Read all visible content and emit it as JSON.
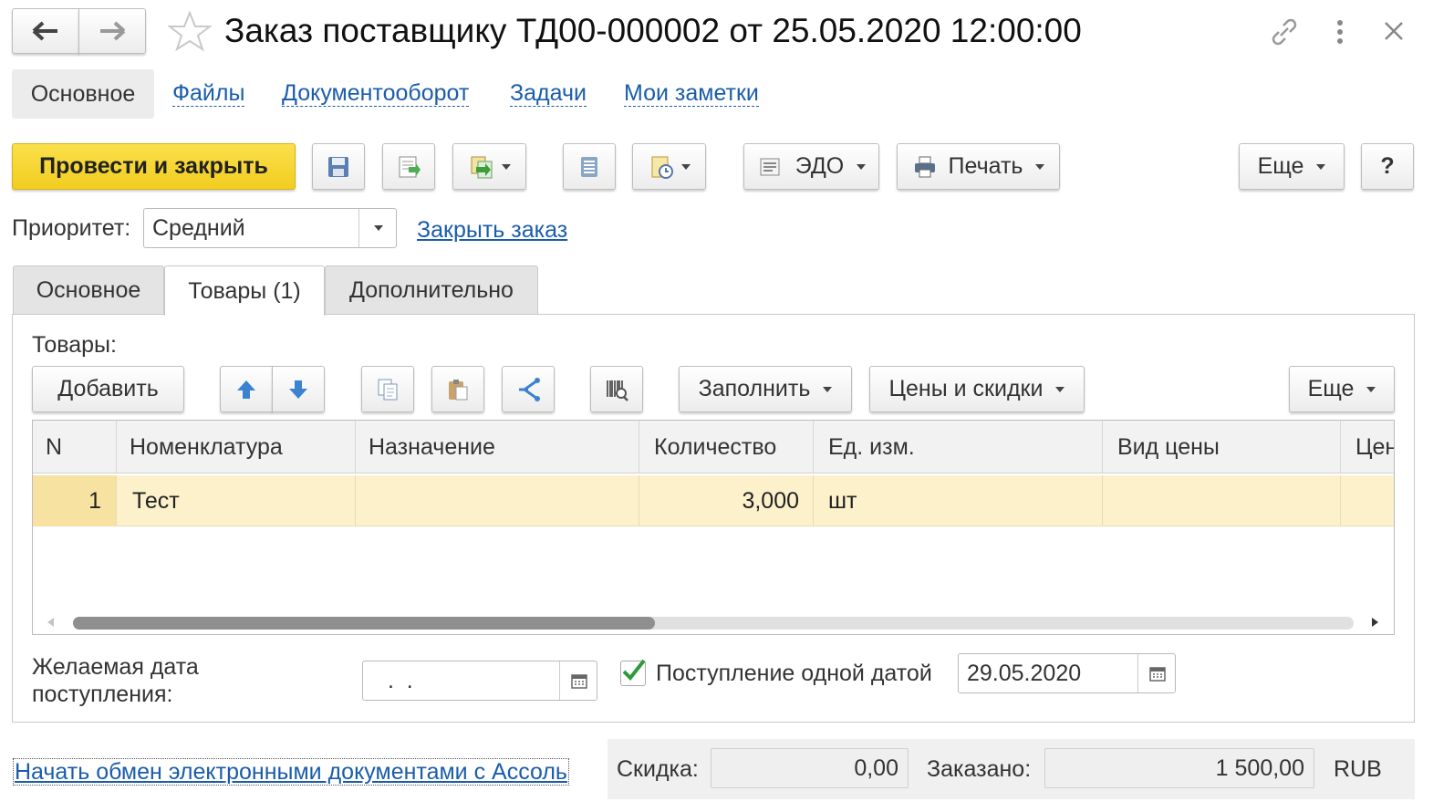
{
  "title": "Заказ поставщику ТД00-000002 от 25.05.2020 12:00:00",
  "nav_tabs": [
    "Основное",
    "Файлы",
    "Документооборот",
    "Задачи",
    "Мои заметки"
  ],
  "toolbar": {
    "post_and_close": "Провести и закрыть",
    "edo": "ЭДО",
    "print": "Печать",
    "more": "Еще",
    "help": "?"
  },
  "priority": {
    "label": "Приоритет:",
    "value": "Средний",
    "close_order_link": "Закрыть заказ"
  },
  "tabs": [
    "Основное",
    "Товары (1)",
    "Дополнительно"
  ],
  "goods": {
    "label": "Товары:",
    "add": "Добавить",
    "fill": "Заполнить",
    "prices": "Цены и скидки",
    "more": "Еще",
    "columns": [
      "N",
      "Номенклатура",
      "Назначение",
      "Количество",
      "Ед. изм.",
      "Вид цены",
      "Цен"
    ],
    "rows": [
      {
        "n": "1",
        "item": "Тест",
        "purpose": "",
        "qty": "3,000",
        "unit": "шт",
        "price_type": "",
        "price": ""
      }
    ]
  },
  "desired_date": {
    "label_line1": "Желаемая дата",
    "label_line2": "поступления:",
    "value": " .  . "
  },
  "single_date": {
    "label": "Поступление одной датой",
    "checked": true,
    "value": "29.05.2020"
  },
  "footer": {
    "edo_link": "Начать обмен электронными документами с Ассоль",
    "discount_label": "Скидка:",
    "discount_value": "0,00",
    "ordered_label": "Заказано:",
    "ordered_value": "1 500,00",
    "currency": "RUB"
  },
  "colors": {
    "primary_button": "#f6d733",
    "selected_row": "#fdf1cc",
    "link": "#1a5dab"
  }
}
